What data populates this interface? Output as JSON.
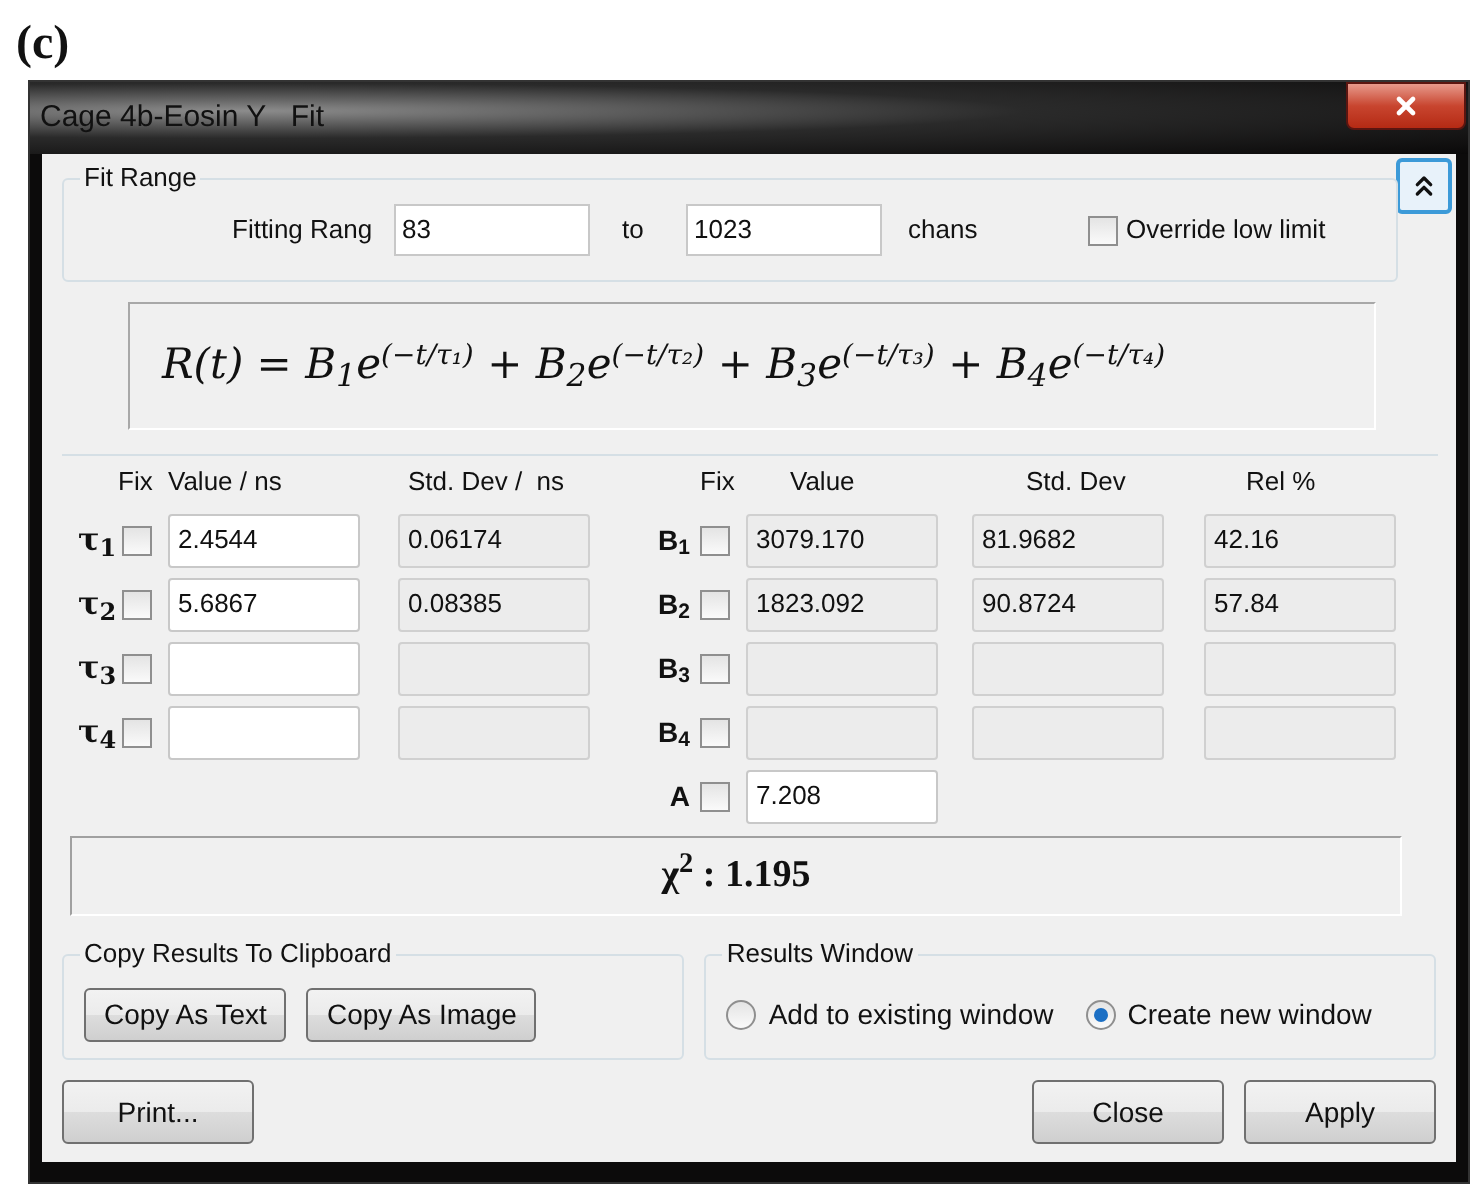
{
  "figure_label": "(c)",
  "window": {
    "title": "Cage 4b-Eosin Y   Fit"
  },
  "fit_range": {
    "title": "Fit Range",
    "label": "Fitting Rang",
    "from": "83",
    "to_label": "to",
    "to": "1023",
    "unit": "chans",
    "override_low_limit": {
      "label": "Override low limit",
      "checked": false
    }
  },
  "formula": {
    "lhs": "R(t) =",
    "terms": [
      {
        "coefficient": "B$_{1}$",
        "base": "e",
        "exponent": "(−t/τ₁)"
      },
      {
        "operator": "+",
        "coefficient": "B$_{2}$",
        "base": "e",
        "exponent": "(−t/τ₂)"
      },
      {
        "operator": "+",
        "coefficient": "B$_{3}$",
        "base": "e",
        "exponent": "(−t/τ₃)"
      },
      {
        "operator": "+",
        "coefficient": "B$_{4}$",
        "base": "e",
        "exponent": "(−t/τ₄)"
      }
    ]
  },
  "lifetimes": {
    "columns": [
      "Fix",
      "Value / ns",
      "Std. Dev /  ns"
    ],
    "rows": [
      {
        "label": "τ$_{1}$",
        "fixed": false,
        "value": "2.4544",
        "std_dev": "0.06174"
      },
      {
        "label": "τ$_{2}$",
        "fixed": false,
        "value": "5.6867",
        "std_dev": "0.08385"
      },
      {
        "label": "τ$_{3}$",
        "fixed": false
      },
      {
        "label": "τ$_{4}$",
        "fixed": false
      }
    ]
  },
  "amplitudes": {
    "columns": [
      "Fix",
      "Value",
      "Std. Dev",
      "Rel %"
    ],
    "rows": [
      {
        "kind": "amplitude",
        "label": "B$_{1}$",
        "fixed": false,
        "value": "3079.170",
        "std_dev": "81.9682",
        "rel": "42.16"
      },
      {
        "kind": "amplitude",
        "label": "B$_{2}$",
        "fixed": false,
        "value": "1823.092",
        "std_dev": "90.8724",
        "rel": "57.84"
      },
      {
        "kind": "amplitude",
        "label": "B$_{3}$",
        "fixed": false
      },
      {
        "kind": "amplitude",
        "label": "B$_{4}$",
        "fixed": false
      },
      {
        "kind": "offset",
        "label": "A",
        "fixed": false,
        "value": "7.208"
      }
    ]
  },
  "chi_squared": "χ$^{2}$ : 1.195",
  "copy_results": {
    "title": "Copy Results To Clipboard",
    "buttons": [
      "Copy As Text",
      "Copy As Image"
    ]
  },
  "results_window": {
    "title": "Results Window",
    "options": [
      {
        "label": "Add to existing window",
        "selected": false
      },
      {
        "label": "Create new window",
        "selected": true
      }
    ]
  },
  "buttons": {
    "print": "Print...",
    "close": "Close",
    "apply": "Apply"
  }
}
